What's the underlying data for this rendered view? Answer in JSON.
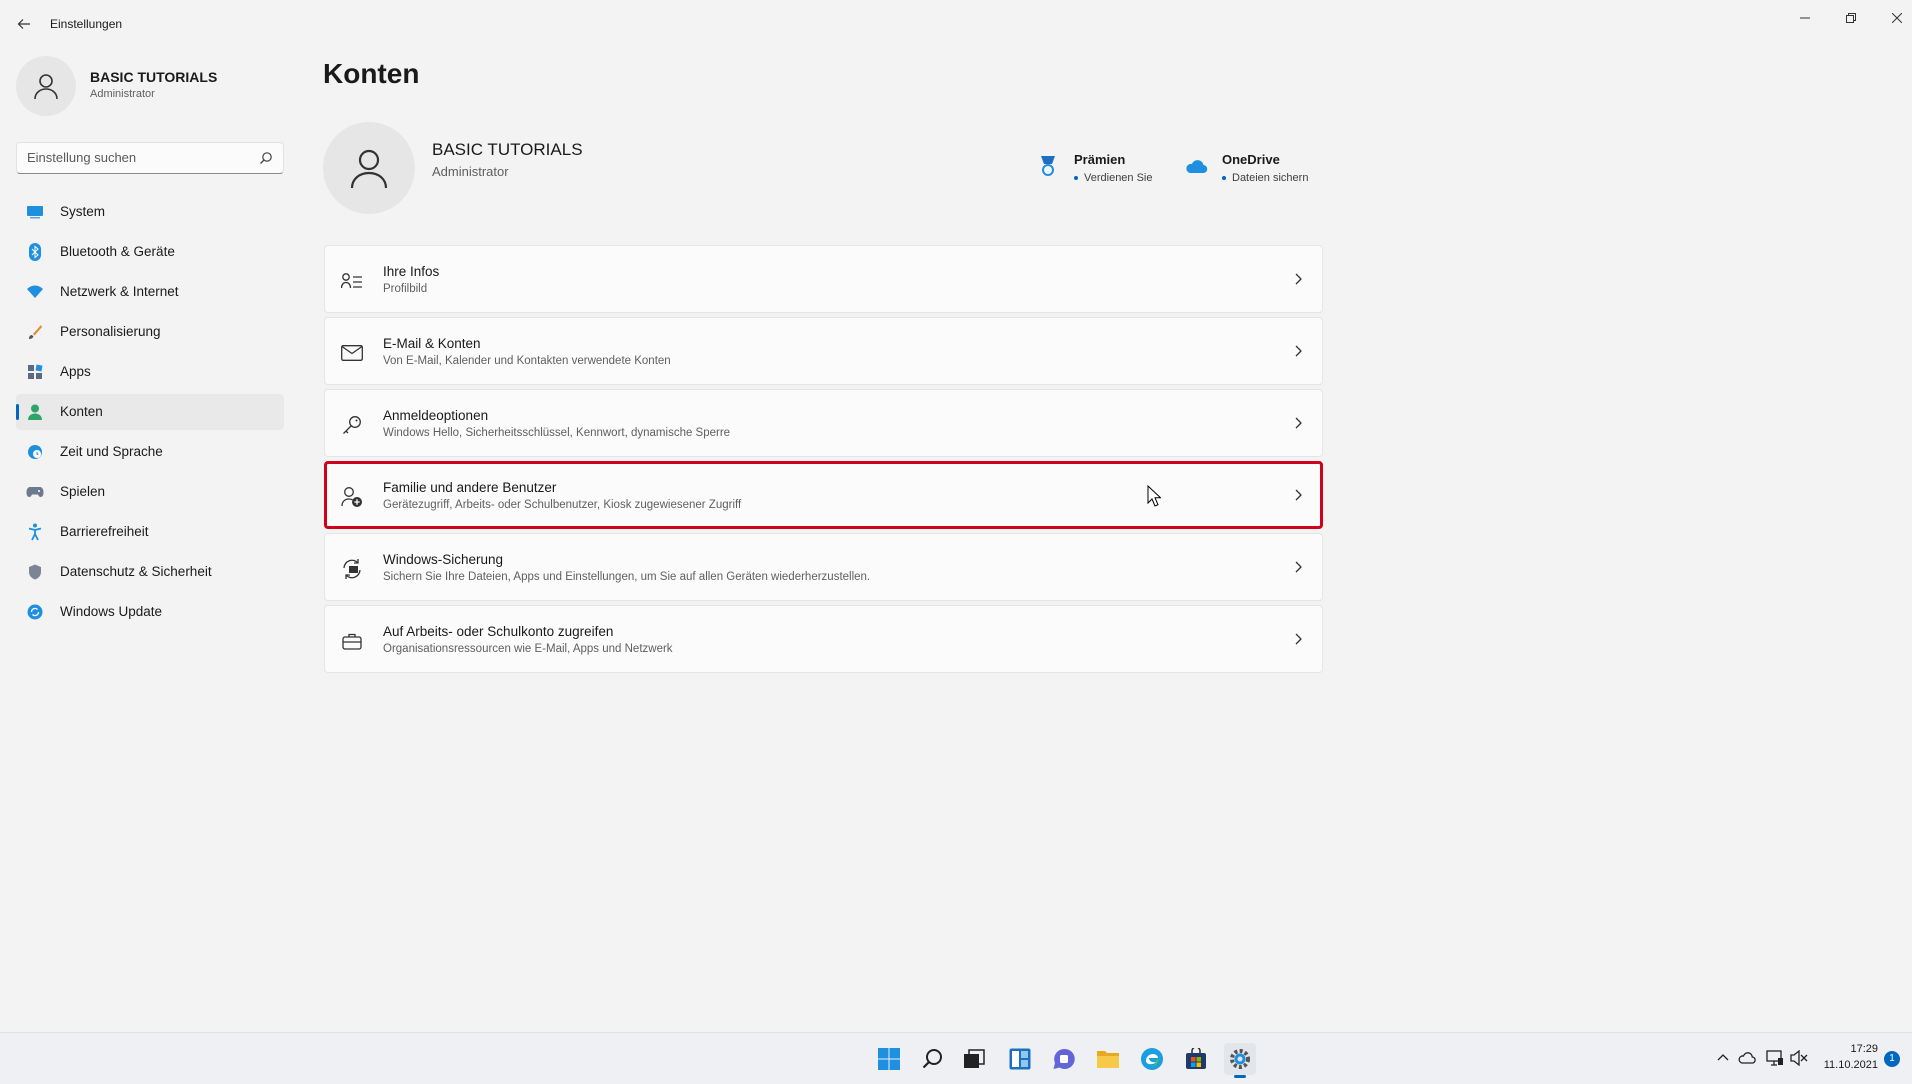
{
  "window": {
    "title": "Einstellungen"
  },
  "sidebar": {
    "profile": {
      "name": "BASIC TUTORIALS",
      "role": "Administrator"
    },
    "search_placeholder": "Einstellung suchen",
    "items": [
      {
        "label": "System",
        "icon": "system-icon"
      },
      {
        "label": "Bluetooth & Geräte",
        "icon": "bluetooth-icon"
      },
      {
        "label": "Netzwerk & Internet",
        "icon": "wifi-icon"
      },
      {
        "label": "Personalisierung",
        "icon": "brush-icon"
      },
      {
        "label": "Apps",
        "icon": "apps-icon"
      },
      {
        "label": "Konten",
        "icon": "person-icon",
        "active": true
      },
      {
        "label": "Zeit und Sprache",
        "icon": "globe-clock-icon"
      },
      {
        "label": "Spielen",
        "icon": "gamepad-icon"
      },
      {
        "label": "Barrierefreiheit",
        "icon": "accessibility-icon"
      },
      {
        "label": "Datenschutz & Sicherheit",
        "icon": "shield-icon"
      },
      {
        "label": "Windows Update",
        "icon": "update-icon"
      }
    ]
  },
  "main": {
    "title": "Konten",
    "profile": {
      "name": "BASIC TUTORIALS",
      "role": "Administrator"
    },
    "quick": [
      {
        "title": "Prämien",
        "subtitle": "Verdienen Sie",
        "icon": "rewards-icon"
      },
      {
        "title": "OneDrive",
        "subtitle": "Dateien sichern",
        "icon": "onedrive-icon"
      }
    ],
    "rows": [
      {
        "title": "Ihre Infos",
        "subtitle": "Profilbild",
        "icon": "person-info-icon"
      },
      {
        "title": "E-Mail & Konten",
        "subtitle": "Von E-Mail, Kalender und Kontakten verwendete Konten",
        "icon": "mail-icon"
      },
      {
        "title": "Anmeldeoptionen",
        "subtitle": "Windows Hello, Sicherheitsschlüssel, Kennwort, dynamische Sperre",
        "icon": "key-icon"
      },
      {
        "title": "Familie und andere Benutzer",
        "subtitle": "Gerätezugriff, Arbeits- oder Schulbenutzer, Kiosk zugewiesener Zugriff",
        "icon": "person-add-icon",
        "highlighted": true
      },
      {
        "title": "Windows-Sicherung",
        "subtitle": "Sichern Sie Ihre Dateien, Apps und Einstellungen, um Sie auf allen Geräten wiederherzustellen.",
        "icon": "backup-icon"
      },
      {
        "title": "Auf Arbeits- oder Schulkonto zugreifen",
        "subtitle": "Organisationsressourcen wie E-Mail, Apps und Netzwerk",
        "icon": "briefcase-icon"
      }
    ]
  },
  "taskbar": {
    "clock_time": "17:29",
    "clock_date": "11.10.2021",
    "notification_count": "1"
  },
  "colors": {
    "accent": "#0067c0",
    "highlight": "#d0021b",
    "background": "#f3f3f3"
  }
}
